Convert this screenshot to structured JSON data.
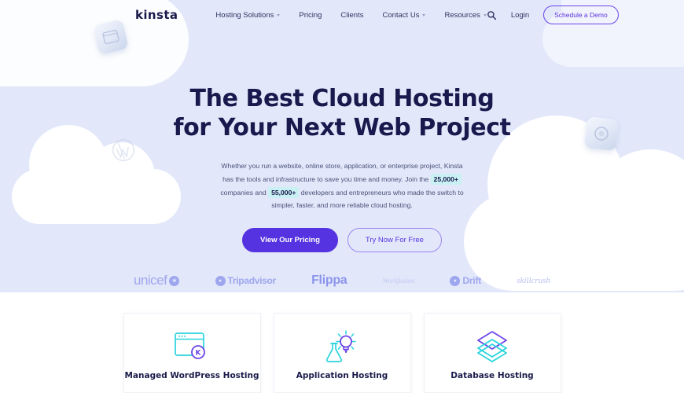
{
  "nav": {
    "logo": "kinsta",
    "items": [
      {
        "label": "Hosting Solutions",
        "has_dropdown": true
      },
      {
        "label": "Pricing",
        "has_dropdown": false
      },
      {
        "label": "Clients",
        "has_dropdown": false
      },
      {
        "label": "Contact Us",
        "has_dropdown": true
      },
      {
        "label": "Resources",
        "has_dropdown": true
      }
    ],
    "search_icon": "search-icon",
    "login_label": "Login",
    "demo_label": "Schedule a Demo"
  },
  "hero": {
    "headline_line1": "The Best Cloud Hosting",
    "headline_line2": "for Your Next Web Project",
    "paragraph_part1": "Whether you run a website, online store, application, or enterprise project, Kinsta has the tools and infrastructure to save you time and money. Join the",
    "stat_companies": "25,000+",
    "paragraph_part2": "companies and",
    "stat_developers": "55,000+",
    "paragraph_part3": "developers and entrepreneurs who made the switch to simpler, faster, and more reliable cloud hosting.",
    "primary_cta": "View Our Pricing",
    "secondary_cta": "Try Now For Free"
  },
  "client_logos": [
    {
      "name": "unicef",
      "label": "unicef"
    },
    {
      "name": "tripadvisor",
      "label": "Tripadvisor"
    },
    {
      "name": "flippa",
      "label": "Flippa"
    },
    {
      "name": "workfusion",
      "label": "Workfusion"
    },
    {
      "name": "drift",
      "label": "Drift"
    },
    {
      "name": "skillcrush",
      "label": "skillcrush"
    }
  ],
  "cards": [
    {
      "title": "Managed WordPress Hosting",
      "icon": "browser-window-kinsta-icon"
    },
    {
      "title": "Application Hosting",
      "icon": "lightbulb-flask-icon"
    },
    {
      "title": "Database Hosting",
      "icon": "stacked-layers-icon"
    }
  ],
  "colors": {
    "hero_background": "#e2e8fa",
    "brand_purple": "#5533e0",
    "accent_teal": "#2ad4dd",
    "headline_navy": "#19194d",
    "highlight_cyan": "#c9f0f3",
    "logo_lavender": "#9ea6ee"
  }
}
